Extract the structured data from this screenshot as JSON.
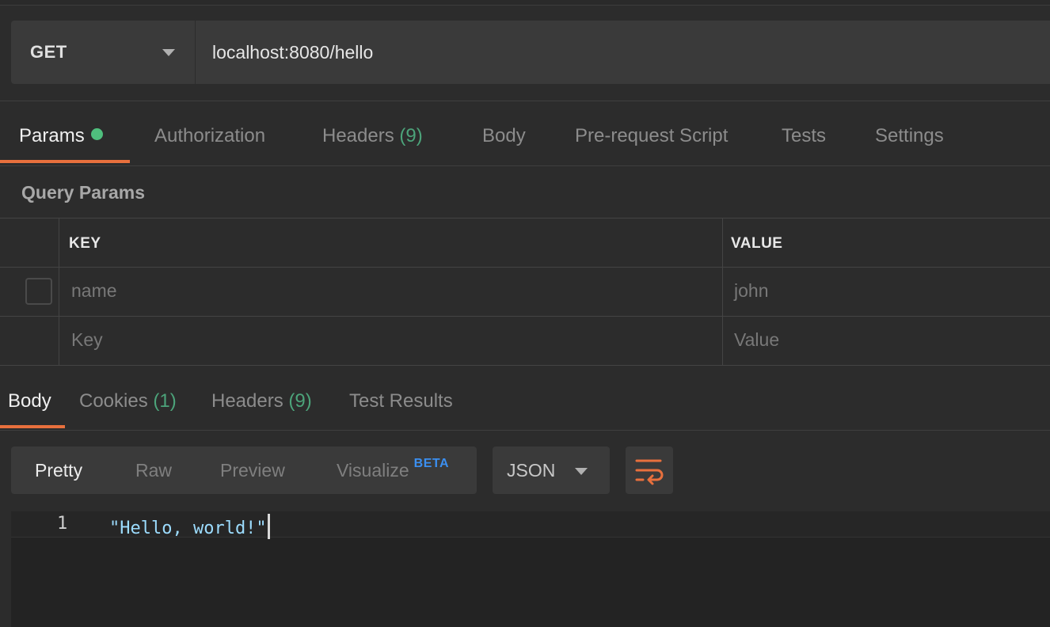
{
  "request": {
    "method": "GET",
    "url": "localhost:8080/hello"
  },
  "request_tabs": [
    {
      "label": "Params",
      "active": true,
      "has_dot": true
    },
    {
      "label": "Authorization"
    },
    {
      "label": "Headers",
      "count": "(9)"
    },
    {
      "label": "Body"
    },
    {
      "label": "Pre-request Script"
    },
    {
      "label": "Tests"
    },
    {
      "label": "Settings"
    }
  ],
  "query_params": {
    "title": "Query Params",
    "columns": {
      "key": "KEY",
      "value": "VALUE"
    },
    "rows": [
      {
        "key": "name",
        "value": "john",
        "checked": false
      }
    ],
    "placeholder": {
      "key": "Key",
      "value": "Value"
    }
  },
  "response_tabs": [
    {
      "label": "Body",
      "active": true
    },
    {
      "label": "Cookies",
      "count": "(1)"
    },
    {
      "label": "Headers",
      "count": "(9)"
    },
    {
      "label": "Test Results"
    }
  ],
  "response_view": {
    "options": [
      {
        "label": "Pretty",
        "active": true
      },
      {
        "label": "Raw"
      },
      {
        "label": "Preview"
      },
      {
        "label": "Visualize",
        "badge": "BETA"
      }
    ],
    "format": "JSON",
    "wrap_icon": "wrap-lines-icon"
  },
  "response_body": {
    "lines": [
      {
        "number": "1",
        "text": "\"Hello, world!\""
      }
    ]
  },
  "colors": {
    "accent": "#e8703d",
    "count": "#4ca37a",
    "dot": "#4fbf7d",
    "beta": "#3b8ff0",
    "string": "#9cdcfe"
  }
}
